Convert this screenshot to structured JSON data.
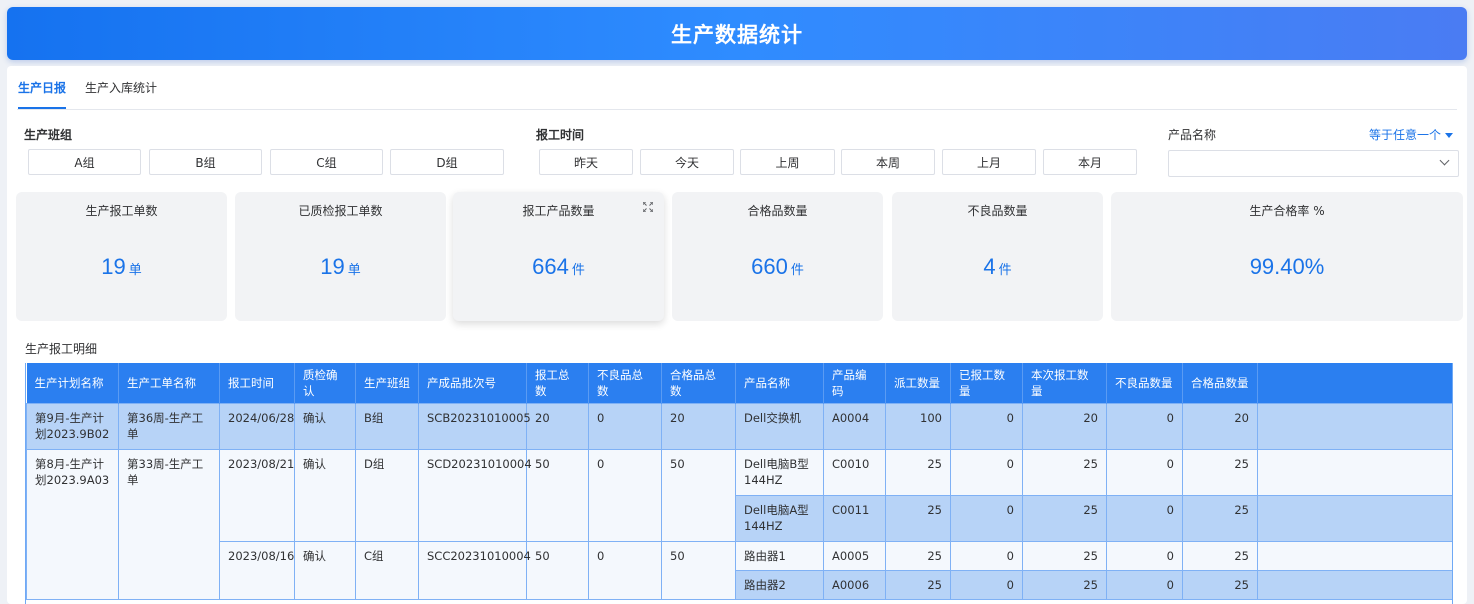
{
  "header": {
    "title": "生产数据统计"
  },
  "tabs": [
    {
      "label": "生产日报"
    },
    {
      "label": "生产入库统计"
    }
  ],
  "filters": {
    "team_label": "生产班组",
    "teams": [
      "A组",
      "B组",
      "C组",
      "D组"
    ],
    "time_label": "报工时间",
    "times": [
      "昨天",
      "今天",
      "上周",
      "本周",
      "上月",
      "本月"
    ],
    "product_label": "产品名称",
    "match_mode": "等于任意一个",
    "product_value": ""
  },
  "cards": [
    {
      "title": "生产报工单数",
      "value": "19",
      "unit": "单"
    },
    {
      "title": "已质检报工单数",
      "value": "19",
      "unit": "单"
    },
    {
      "title": "报工产品数量",
      "value": "664",
      "unit": "件"
    },
    {
      "title": "合格品数量",
      "value": "660",
      "unit": "件"
    },
    {
      "title": "不良品数量",
      "value": "4",
      "unit": "件"
    },
    {
      "title": "生产合格率 %",
      "value": "99.40%",
      "unit": ""
    }
  ],
  "table": {
    "title": "生产报工明细",
    "columns": [
      "生产计划名称",
      "生产工单名称",
      "报工时间",
      "质检确认",
      "生产班组",
      "产成品批次号",
      "报工总数",
      "不良品总数",
      "合格品总数",
      "产品名称",
      "产品编码",
      "派工数量",
      "已报工数量",
      "本次报工数量",
      "不良品数量",
      "合格品数量"
    ],
    "rows": [
      {
        "plan": "第9月-生产计划2023.9B02",
        "order": "第36周-生产工单",
        "time": "2024/06/28",
        "qc": "确认",
        "team": "B组",
        "batch": "SCB20231010005",
        "total": "20",
        "bad_total": "0",
        "good_total": "20",
        "product": "Dell交换机",
        "code": "A0004",
        "dispatch": "100",
        "reported": "0",
        "current": "20",
        "bad": "0",
        "good": "20"
      },
      {
        "plan": "第8月-生产计划2023.9A03",
        "order": "第33周-生产工单",
        "time": "2023/08/21",
        "qc": "确认",
        "team": "D组",
        "batch": "SCD20231010004",
        "total": "50",
        "bad_total": "0",
        "good_total": "50",
        "product": "Dell电脑B型144HZ",
        "code": "C0010",
        "dispatch": "25",
        "reported": "0",
        "current": "25",
        "bad": "0",
        "good": "25"
      },
      {
        "product": "Dell电脑A型144HZ",
        "code": "C0011",
        "dispatch": "25",
        "reported": "0",
        "current": "25",
        "bad": "0",
        "good": "25"
      },
      {
        "time": "2023/08/16",
        "qc": "确认",
        "team": "C组",
        "batch": "SCC20231010004",
        "total": "50",
        "bad_total": "0",
        "good_total": "50",
        "product": "路由器1",
        "code": "A0005",
        "dispatch": "25",
        "reported": "0",
        "current": "25",
        "bad": "0",
        "good": "25"
      },
      {
        "product": "路由器2",
        "code": "A0006",
        "dispatch": "25",
        "reported": "0",
        "current": "25",
        "bad": "0",
        "good": "25"
      }
    ]
  },
  "colors": {
    "accent": "#1a73e8",
    "header_from": "#1572f0",
    "table_header": "#2b7ff0",
    "row_highlight": "#b7d3f7"
  }
}
